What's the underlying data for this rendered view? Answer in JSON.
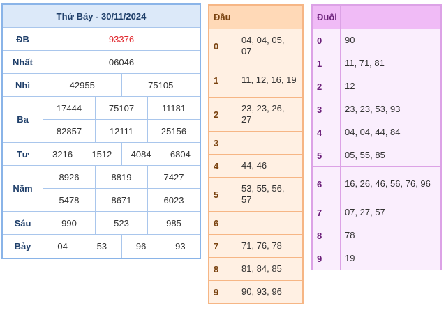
{
  "results": {
    "title": "Thứ Bảy - 30/11/2024",
    "prizes": [
      {
        "label": "ĐB",
        "rows": [
          [
            "93376"
          ]
        ]
      },
      {
        "label": "Nhất",
        "rows": [
          [
            "06046"
          ]
        ]
      },
      {
        "label": "Nhì",
        "rows": [
          [
            "42955",
            "75105"
          ]
        ]
      },
      {
        "label": "Ba",
        "rows": [
          [
            "17444",
            "75107",
            "11181"
          ],
          [
            "82857",
            "12111",
            "25156"
          ]
        ]
      },
      {
        "label": "Tư",
        "rows": [
          [
            "3216",
            "1512",
            "4084",
            "6804"
          ]
        ]
      },
      {
        "label": "Năm",
        "rows": [
          [
            "8926",
            "8819",
            "7427"
          ],
          [
            "5478",
            "8671",
            "6023"
          ]
        ]
      },
      {
        "label": "Sáu",
        "rows": [
          [
            "990",
            "523",
            "985"
          ]
        ]
      },
      {
        "label": "Bảy",
        "rows": [
          [
            "04",
            "53",
            "96",
            "93"
          ]
        ]
      }
    ],
    "special_color": "#e0242a"
  },
  "dau": {
    "header": "Đầu",
    "rows": [
      {
        "key": "0",
        "value": "04, 04, 05, 07"
      },
      {
        "key": "1",
        "value": "11, 12, 16, 19"
      },
      {
        "key": "2",
        "value": "23, 23, 26, 27"
      },
      {
        "key": "3",
        "value": ""
      },
      {
        "key": "4",
        "value": "44, 46"
      },
      {
        "key": "5",
        "value": "53, 55, 56, 57"
      },
      {
        "key": "6",
        "value": ""
      },
      {
        "key": "7",
        "value": "71, 76, 78"
      },
      {
        "key": "8",
        "value": "81, 84, 85"
      },
      {
        "key": "9",
        "value": "90, 93, 96"
      }
    ]
  },
  "duoi": {
    "header": "Đuôi",
    "rows": [
      {
        "key": "0",
        "value": "90"
      },
      {
        "key": "1",
        "value": "11, 71, 81"
      },
      {
        "key": "2",
        "value": "12"
      },
      {
        "key": "3",
        "value": "23, 23, 53, 93"
      },
      {
        "key": "4",
        "value": "04, 04, 44, 84"
      },
      {
        "key": "5",
        "value": "05, 55, 85"
      },
      {
        "key": "6",
        "value": "16, 26, 46, 56, 76, 96"
      },
      {
        "key": "7",
        "value": "07, 27, 57"
      },
      {
        "key": "8",
        "value": "78"
      },
      {
        "key": "9",
        "value": "19"
      }
    ]
  }
}
